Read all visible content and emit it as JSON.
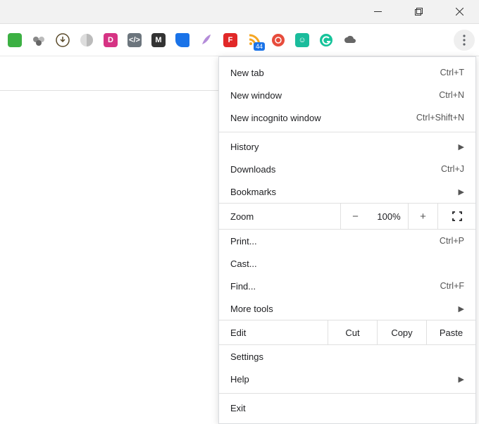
{
  "toolbar": {
    "rss_badge": "44"
  },
  "menu": {
    "new_tab": {
      "label": "New tab",
      "shortcut": "Ctrl+T"
    },
    "new_window": {
      "label": "New window",
      "shortcut": "Ctrl+N"
    },
    "incognito": {
      "label": "New incognito window",
      "shortcut": "Ctrl+Shift+N"
    },
    "history": {
      "label": "History"
    },
    "downloads": {
      "label": "Downloads",
      "shortcut": "Ctrl+J"
    },
    "bookmarks": {
      "label": "Bookmarks"
    },
    "zoom": {
      "label": "Zoom",
      "minus": "−",
      "value": "100%",
      "plus": "+"
    },
    "print": {
      "label": "Print...",
      "shortcut": "Ctrl+P"
    },
    "cast": {
      "label": "Cast..."
    },
    "find": {
      "label": "Find...",
      "shortcut": "Ctrl+F"
    },
    "more_tools": {
      "label": "More tools"
    },
    "edit": {
      "label": "Edit",
      "cut": "Cut",
      "copy": "Copy",
      "paste": "Paste"
    },
    "settings": {
      "label": "Settings"
    },
    "help": {
      "label": "Help"
    },
    "exit": {
      "label": "Exit"
    }
  }
}
